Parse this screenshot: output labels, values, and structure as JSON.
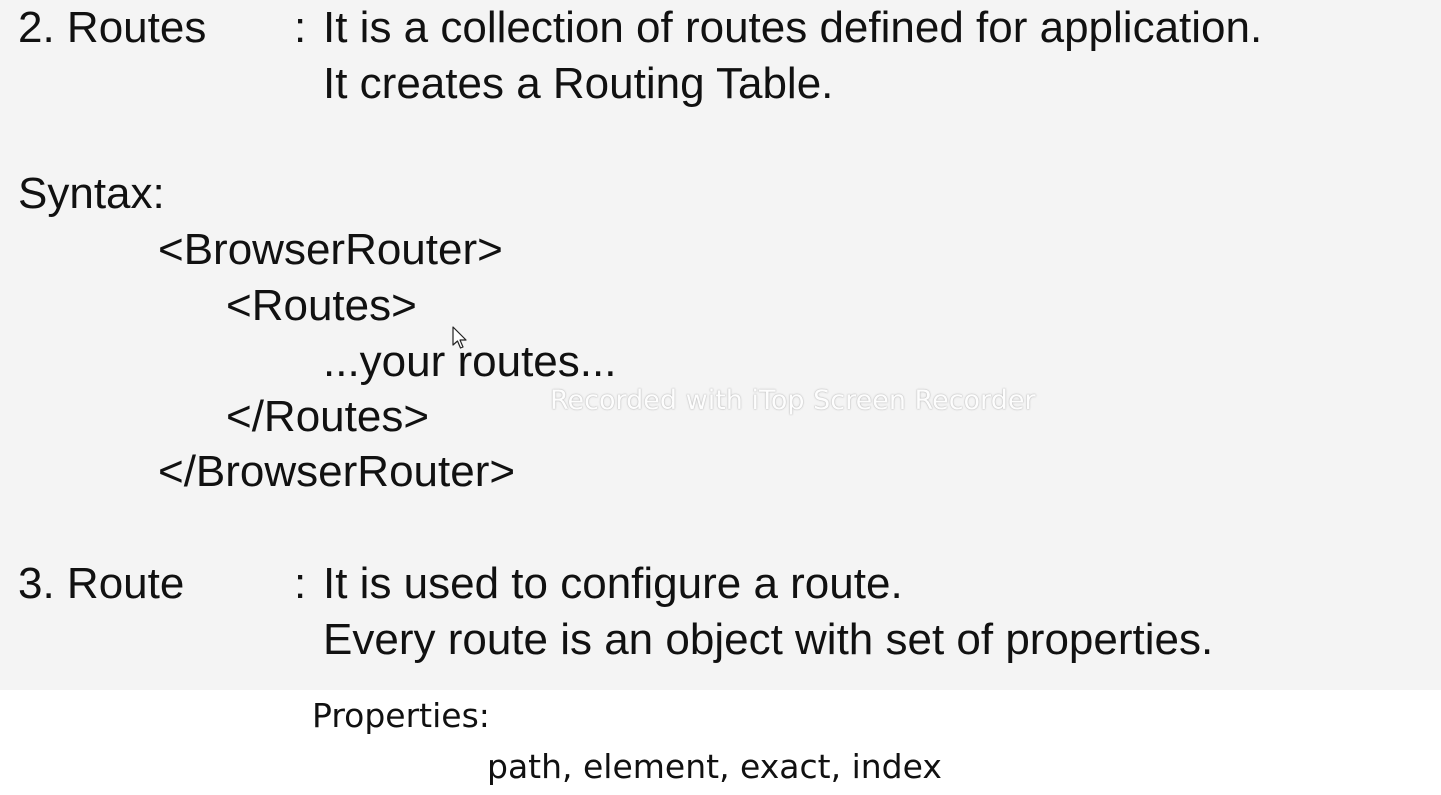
{
  "slide": {
    "routes_item": {
      "label": "2. Routes",
      "separator": ":",
      "line1": "It is a collection of routes defined for application.",
      "line2": "It creates a Routing Table."
    },
    "syntax": {
      "heading": "Syntax:",
      "code": [
        "<BrowserRouter>",
        "<Routes>",
        "...your routes...",
        "</Routes>",
        "</BrowserRouter>"
      ]
    },
    "route_item": {
      "label": "3. Route",
      "separator": ":",
      "line1": "It is used to configure a route.",
      "line2": "Every route is an object with set of properties."
    }
  },
  "notes": {
    "properties_heading": "Properties:",
    "properties_list": "path, element, exact, index"
  },
  "watermark": {
    "text": "Recorded with iTop Screen Recorder"
  },
  "icons": {
    "cursor": "mouse-pointer-icon"
  }
}
